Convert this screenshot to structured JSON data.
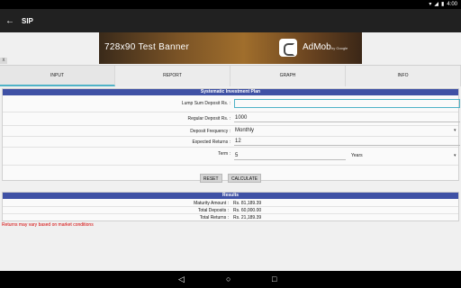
{
  "status_bar": {
    "time": "4:00",
    "icons": [
      "wifi-icon",
      "signal-icon",
      "battery-icon"
    ]
  },
  "app_bar": {
    "title": "SIP",
    "back_icon": "arrow-back-icon"
  },
  "ad": {
    "text": "728x90   Test Banner",
    "brand": "AdMob",
    "brand_sub": "by Google",
    "close": "x"
  },
  "tabs": [
    {
      "label": "INPUT",
      "active": true
    },
    {
      "label": "REPORT",
      "active": false
    },
    {
      "label": "GRAPH",
      "active": false
    },
    {
      "label": "INFO",
      "active": false
    }
  ],
  "plan": {
    "heading": "Systematic Investment Plan",
    "lump_sum_label": "Lump Sum Deposit Rs. :",
    "lump_sum_value": "",
    "regular_label": "Regular Deposit Rs. :",
    "regular_value": "1000",
    "frequency_label": "Deposit Frequency :",
    "frequency_value": "Monthly",
    "expected_label": "Expected Returns :",
    "expected_value": "12",
    "term_label": "Term :",
    "term_value": "5",
    "term_unit": "Years",
    "reset_label": "RESET",
    "calculate_label": "CALCULATE"
  },
  "results": {
    "heading": "Results",
    "rows": [
      {
        "label": "Maturity Amount :",
        "value": "Rs. 81,189.39"
      },
      {
        "label": "Total Deposits :",
        "value": "Rs. 60,000.00"
      },
      {
        "label": "Total Returns :",
        "value": "Rs. 21,189.39"
      }
    ]
  },
  "note": "Returns may vary based on market conditions",
  "nav_bar": {
    "back": "◁",
    "home": "○",
    "recents": "□"
  },
  "colors": {
    "accent": "#4fb3c7",
    "header_blue": "#3f51a5",
    "note_red": "#d50000"
  }
}
